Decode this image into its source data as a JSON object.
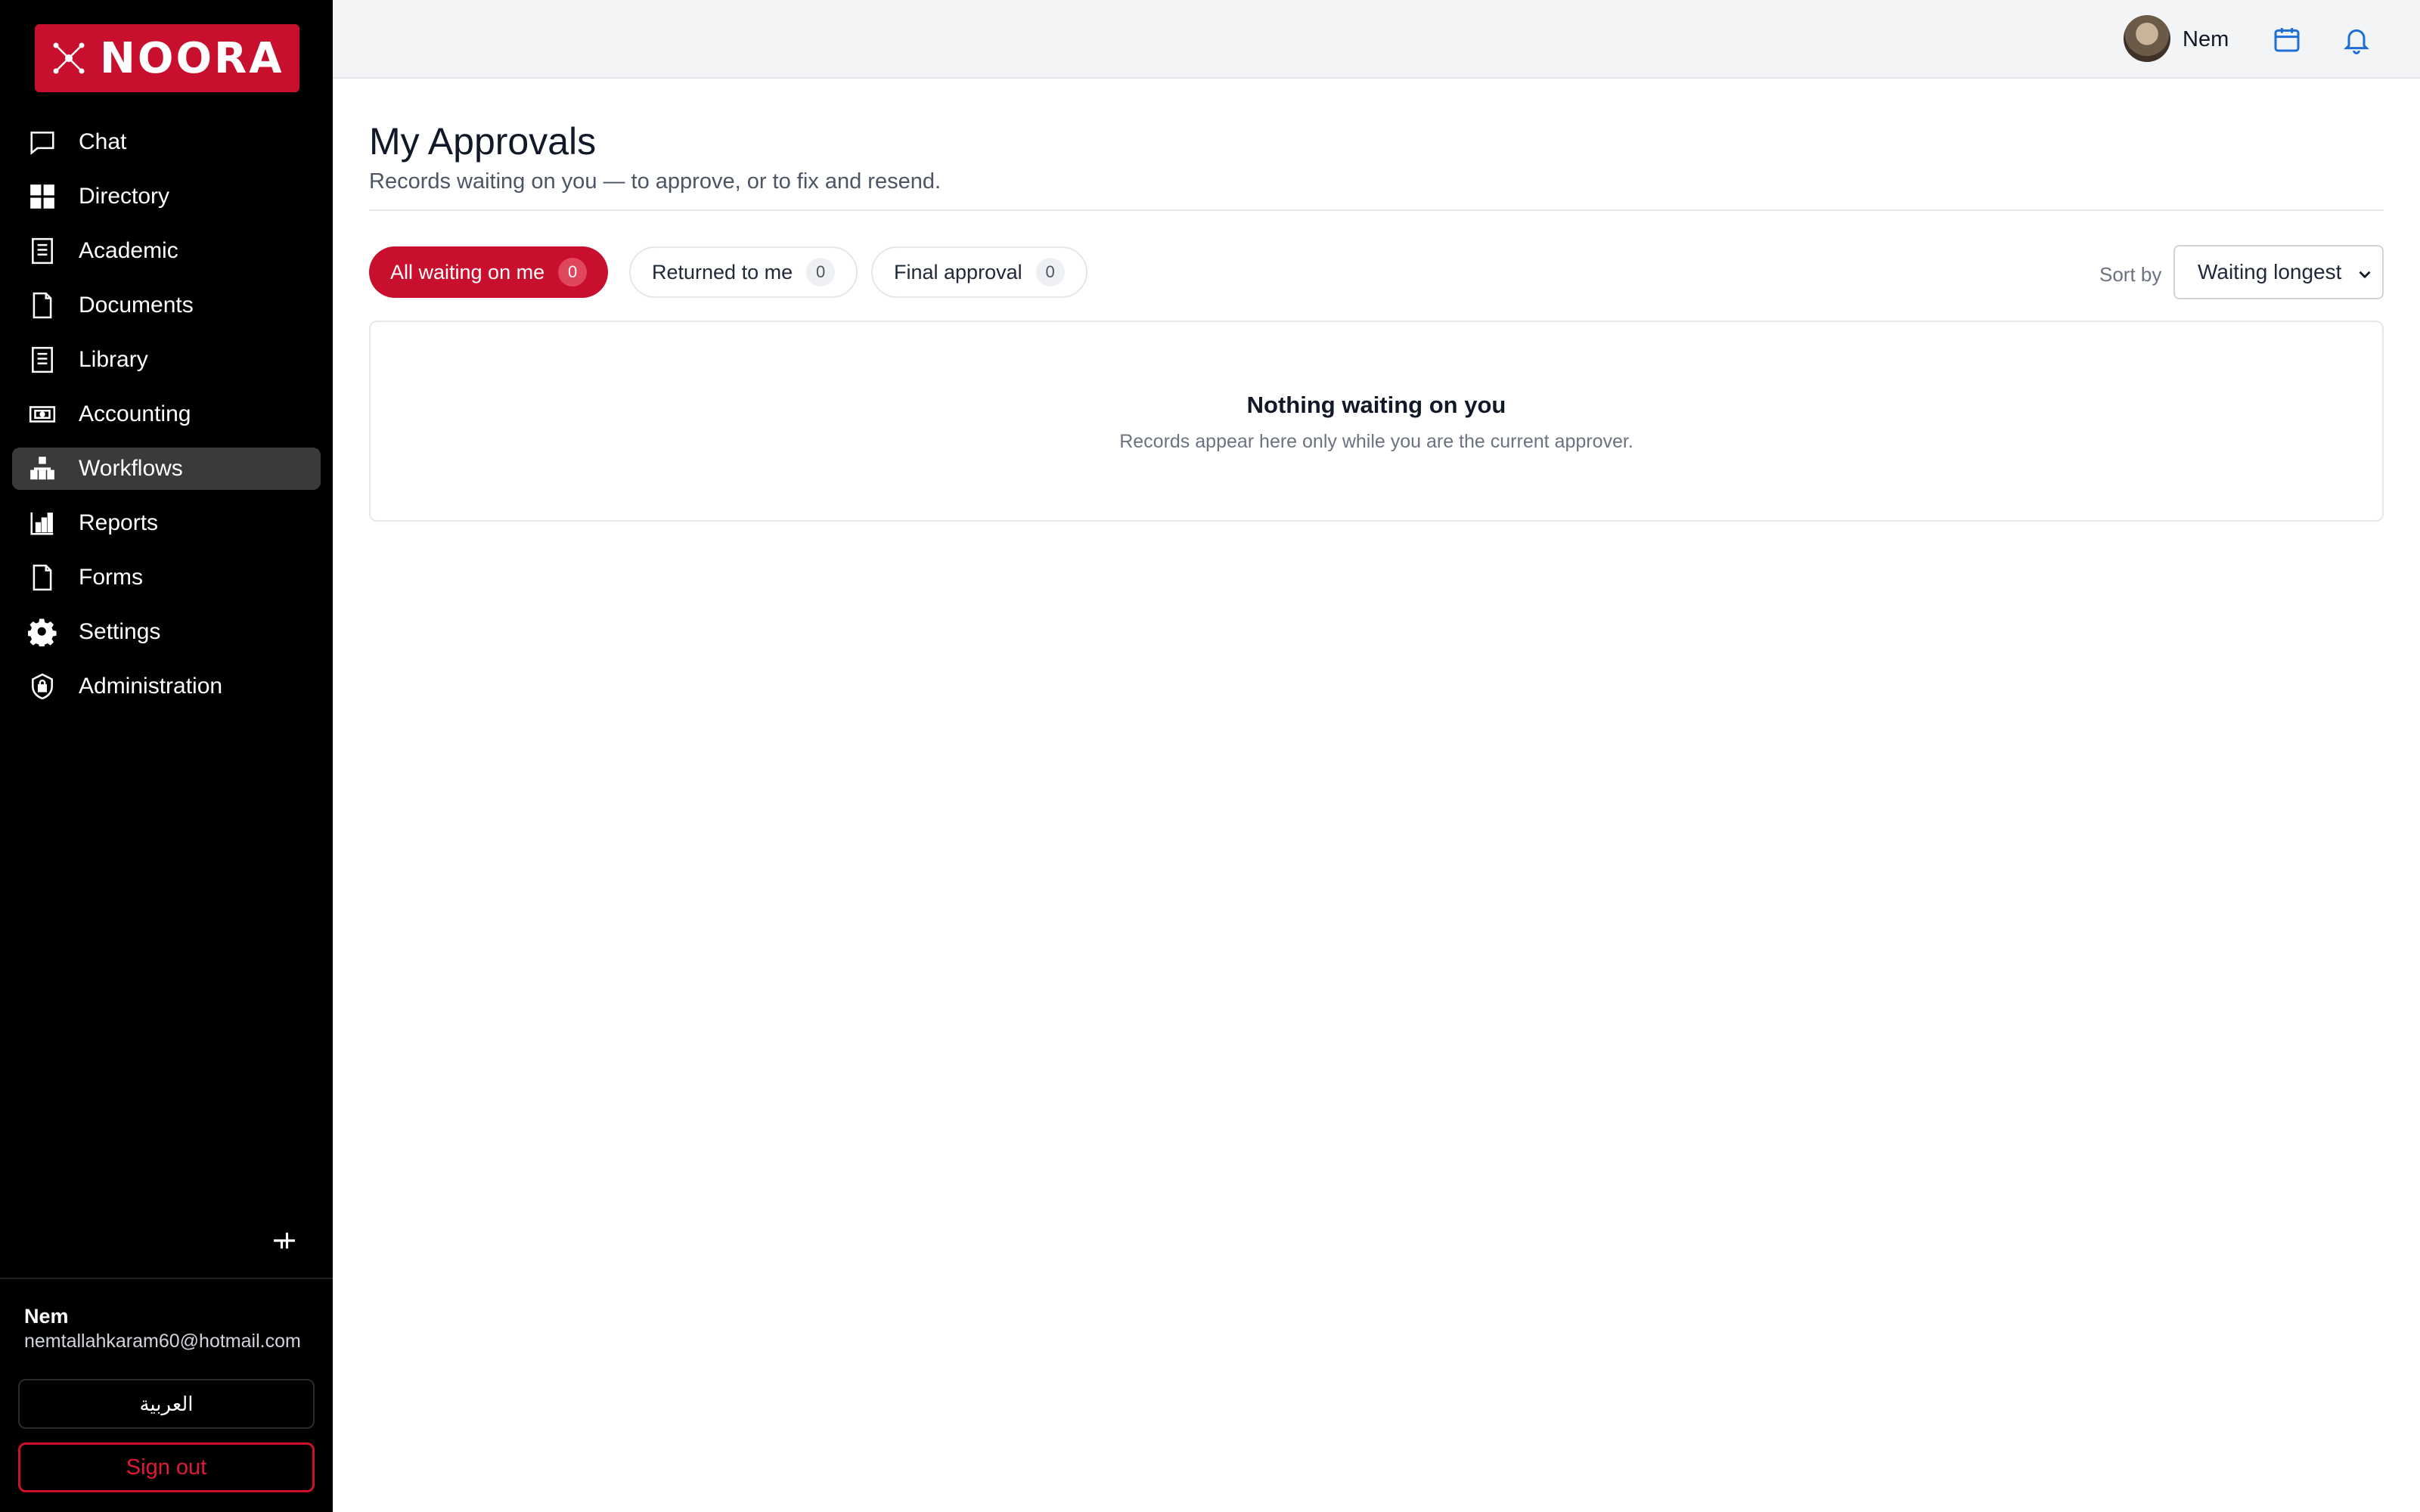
{
  "brand": {
    "name": "NOORA",
    "color": "#c8102e"
  },
  "sidebar": {
    "items": [
      {
        "label": "Chat",
        "icon": "chat-icon"
      },
      {
        "label": "Directory",
        "icon": "grid-icon"
      },
      {
        "label": "Academic",
        "icon": "book-icon"
      },
      {
        "label": "Documents",
        "icon": "document-icon"
      },
      {
        "label": "Library",
        "icon": "book-icon"
      },
      {
        "label": "Accounting",
        "icon": "money-icon"
      },
      {
        "label": "Workflows",
        "icon": "workflow-icon",
        "active": true
      },
      {
        "label": "Reports",
        "icon": "chart-icon"
      },
      {
        "label": "Forms",
        "icon": "document-icon"
      },
      {
        "label": "Settings",
        "icon": "gear-icon"
      },
      {
        "label": "Administration",
        "icon": "shield-icon"
      }
    ],
    "user": {
      "name": "Nem",
      "email": "nemtallahkaram60@hotmail.com"
    },
    "language_button": "العربية",
    "sign_out": "Sign out"
  },
  "header": {
    "user_name": "Nem"
  },
  "main": {
    "title": "My Approvals",
    "subtitle": "Records waiting on you — to approve, or to fix and resend.",
    "tabs": [
      {
        "label": "All waiting on me",
        "count": "0",
        "active": true
      },
      {
        "label": "Returned to me",
        "count": "0",
        "active": false
      },
      {
        "label": "Final approval",
        "count": "0",
        "active": false
      }
    ],
    "sort": {
      "label": "Sort by",
      "value": "Waiting longest"
    },
    "empty": {
      "title": "Nothing waiting on you",
      "message": "Records appear here only while you are the current approver."
    }
  }
}
